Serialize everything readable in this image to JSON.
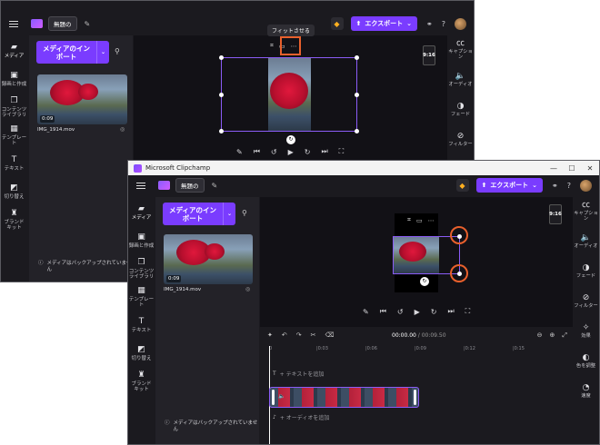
{
  "app": {
    "title": "Microsoft Clipchamp",
    "project_name": "無題の​",
    "export_label": "エクスポート",
    "window_controls": [
      "—",
      "☐",
      "✕"
    ]
  },
  "nav": {
    "items": [
      {
        "label": "メディア",
        "icon": "folder-icon"
      },
      {
        "label": "録画と作成",
        "icon": "camera-icon"
      },
      {
        "label": "コンテンツ ライブラリ",
        "icon": "library-icon"
      },
      {
        "label": "テンプレート",
        "icon": "template-icon"
      },
      {
        "label": "テキスト",
        "icon": "text-icon"
      },
      {
        "label": "切り替え",
        "icon": "transition-icon"
      },
      {
        "label": "ブランド キット",
        "icon": "brand-icon"
      }
    ]
  },
  "media": {
    "import_label": "メディアのインポート",
    "file_name": "IMG_1914.mov",
    "duration": "0:09",
    "backup_text": "メディアはバックアップされていません"
  },
  "right": {
    "items": [
      {
        "label": "キャプション",
        "icon": "cc-icon"
      },
      {
        "label": "オーディオ",
        "icon": "speaker-icon"
      },
      {
        "label": "フェード",
        "icon": "fade-icon"
      },
      {
        "label": "フィルター",
        "icon": "filter-icon"
      },
      {
        "label": "効果",
        "icon": "effects-icon"
      },
      {
        "label": "色を調整",
        "icon": "color-icon"
      },
      {
        "label": "速度",
        "icon": "speed-icon"
      }
    ]
  },
  "stage": {
    "aspect_ratio": "9:16",
    "tooltip": "フィットさせる"
  },
  "timeline": {
    "time_current": "00:00.00",
    "time_total": "00:09.50",
    "ruler": [
      "0",
      "|0:03",
      "|0:06",
      "|0:09",
      "|0:12",
      "|0:15"
    ],
    "add_text": "+ テキストを追加",
    "add_audio": "+ オーディオを追加"
  },
  "colors": {
    "accent": "#7a3cff",
    "highlight": "#e8602c"
  }
}
